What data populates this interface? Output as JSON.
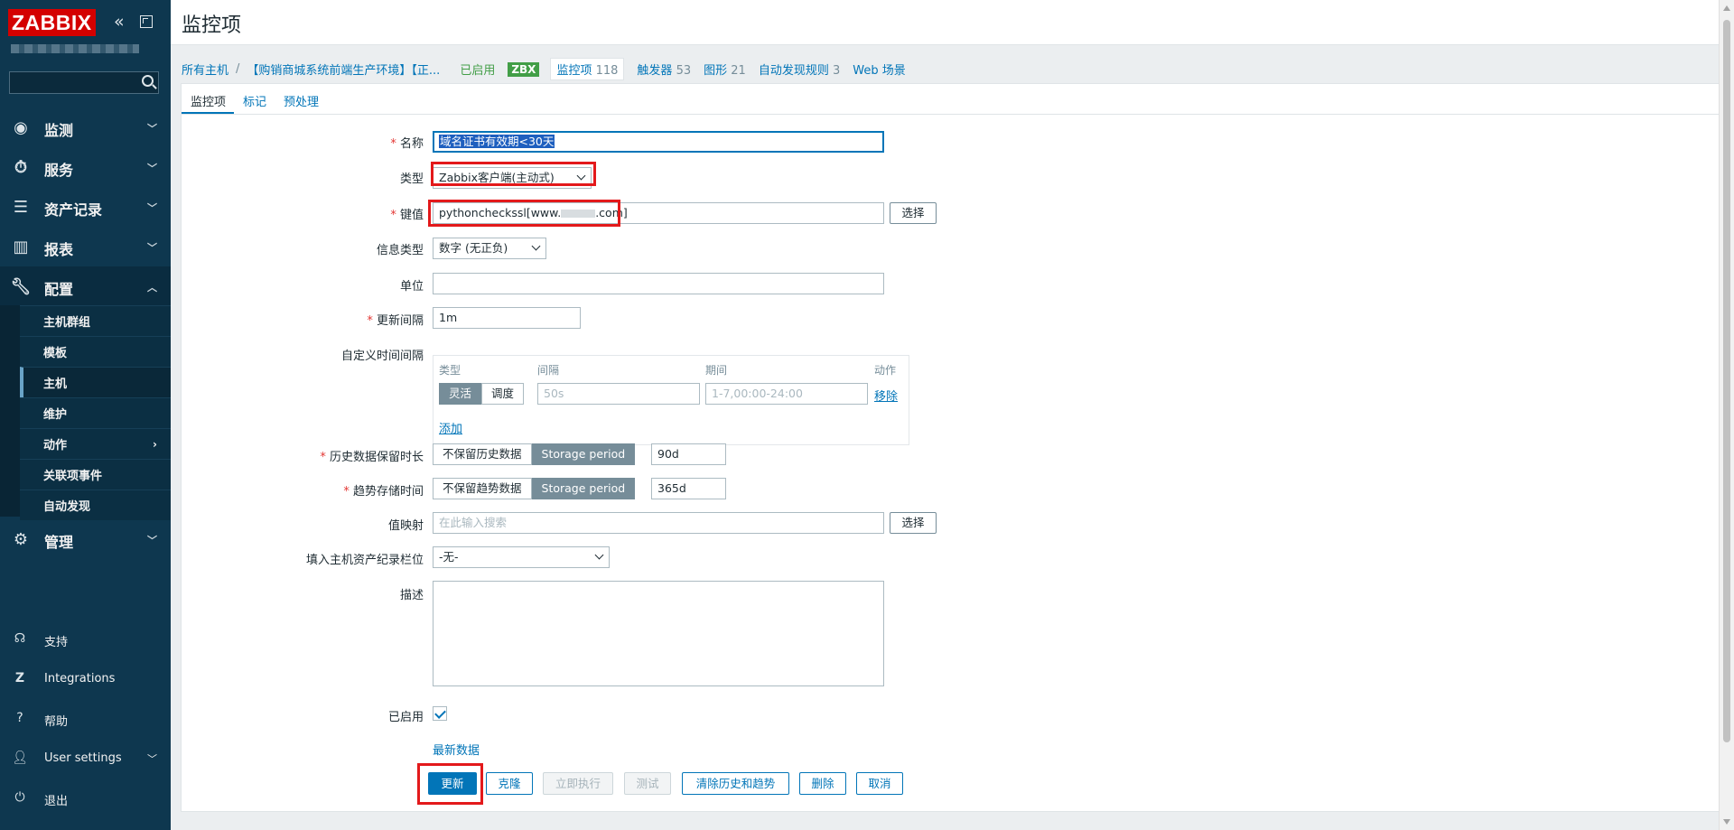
{
  "app": {
    "logo": "ZABBIX"
  },
  "sidebar": {
    "nav": [
      {
        "label": "监测",
        "icon": "eye-icon"
      },
      {
        "label": "服务",
        "icon": "stopwatch-icon"
      },
      {
        "label": "资产记录",
        "icon": "list-icon"
      },
      {
        "label": "报表",
        "icon": "bar-chart-icon"
      },
      {
        "label": "配置",
        "icon": "wrench-icon"
      },
      {
        "label": "管理",
        "icon": "gear-icon"
      }
    ],
    "config_items": [
      "主机群组",
      "模板",
      "主机",
      "维护",
      "动作",
      "关联项事件",
      "自动发现"
    ],
    "bottom": [
      {
        "label": "支持",
        "icon": "headset-icon"
      },
      {
        "label": "Integrations",
        "icon": "zabbix-z-icon"
      },
      {
        "label": "帮助",
        "icon": "question-icon"
      },
      {
        "label": "User settings",
        "icon": "user-icon"
      },
      {
        "label": "退出",
        "icon": "power-icon"
      }
    ]
  },
  "header": {
    "title": "监控项"
  },
  "breadcrumb": {
    "all_hosts": "所有主机",
    "host": "【购销商城系统前端生产环境】【正...",
    "enabled": "已启用",
    "zbx": "ZBX",
    "items_label": "监控项",
    "items_count": "118",
    "triggers_label": "触发器",
    "triggers_count": "53",
    "graphs_label": "图形",
    "graphs_count": "21",
    "discovery_label": "自动发现规则",
    "discovery_count": "3",
    "web_label": "Web 场景"
  },
  "tabs": [
    "监控项",
    "标记",
    "预处理"
  ],
  "form": {
    "name_label": "名称",
    "name_value": "域名证书有效期<30天",
    "type_label": "类型",
    "type_value": "Zabbix客户端(主动式)",
    "key_label": "键值",
    "key_value_prefix": "pythoncheckssl[www.",
    "key_value_suffix": ".com]",
    "select_label": "选择",
    "info_type_label": "信息类型",
    "info_type_value": "数字 (无正负)",
    "units_label": "单位",
    "interval_label": "更新间隔",
    "interval_value": "1m",
    "custom_intervals_label": "自定义时间间隔",
    "ci_headers": {
      "type": "类型",
      "interval": "间隔",
      "period": "期间",
      "action": "动作"
    },
    "ci_flexible": "灵活",
    "ci_scheduling": "调度",
    "ci_interval_placeholder": "50s",
    "ci_period_placeholder": "1-7,00:00-24:00",
    "ci_remove": "移除",
    "ci_add": "添加",
    "history_label": "历史数据保留时长",
    "history_no_keep": "不保留历史数据",
    "storage_period": "Storage period",
    "history_value": "90d",
    "trends_label": "趋势存储时间",
    "trends_no_keep": "不保留趋势数据",
    "trends_value": "365d",
    "valuemap_label": "值映射",
    "valuemap_placeholder": "在此输入搜索",
    "inventory_label": "填入主机资产纪录栏位",
    "inventory_value": "-无-",
    "description_label": "描述",
    "enabled_label": "已启用",
    "latest_data": "最新数据"
  },
  "buttons": {
    "update": "更新",
    "clone": "克隆",
    "execute_now": "立即执行",
    "test": "测试",
    "clear_history": "清除历史和趋势",
    "delete": "删除",
    "cancel": "取消"
  },
  "colors": {
    "brand": "#d40000",
    "sidebar": "#0e374f",
    "link": "#0275b8",
    "enabled": "#429e47",
    "highlight_box": "#e3191b"
  }
}
